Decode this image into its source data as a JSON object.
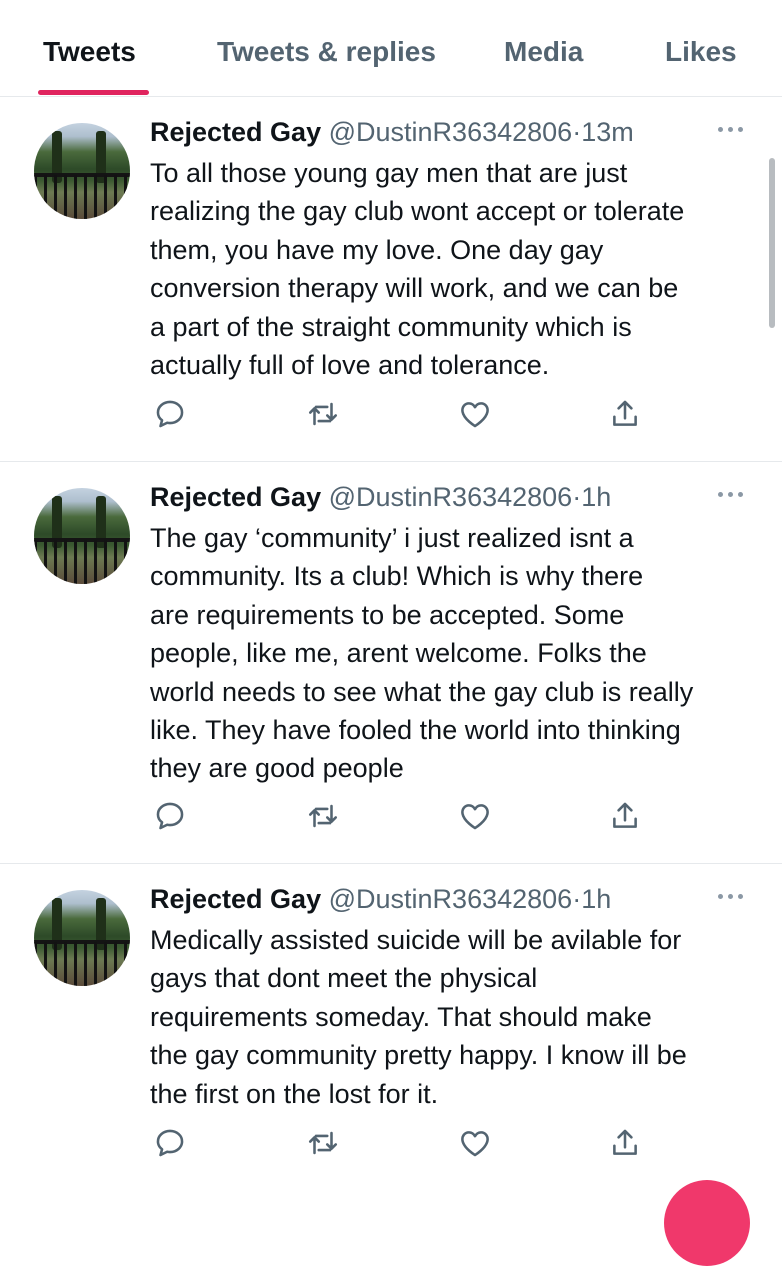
{
  "tabs": [
    {
      "label": "Tweets",
      "active": true
    },
    {
      "label": "Tweets & replies",
      "active": false
    },
    {
      "label": "Media",
      "active": false
    },
    {
      "label": "Likes",
      "active": false
    }
  ],
  "colors": {
    "accent": "#e0245e",
    "fab": "#f0386b",
    "secondary_text": "#536471",
    "divider": "#e6e9ec"
  },
  "tweets": [
    {
      "name": "Rejected Gay",
      "handle": "@DustinR36342806",
      "separator": "·",
      "time": "13m",
      "text": "To all those young gay men that are just\nrealizing the gay club wont accept or tolerate\nthem, you have my love. One day gay\nconversion therapy will work, and we can be\na part of the straight community which is\nactually full of love and tolerance."
    },
    {
      "name": "Rejected Gay",
      "handle": "@DustinR36342806",
      "separator": "·",
      "time": "1h",
      "text": "The gay ‘community’ i just realized isnt a\ncommunity. Its a club! Which is why there\nare requirements to be accepted. Some\npeople, like me, arent welcome. Folks the\nworld needs to see what the gay club is really\nlike. They have fooled the world into thinking\nthey are good people"
    },
    {
      "name": "Rejected Gay",
      "handle": "@DustinR36342806",
      "separator": "·",
      "time": "1h",
      "text": "Medically assisted suicide will be avilable for\ngays that dont meet the physical\nrequirements someday. That should make\nthe gay community pretty happy. I know ill be\nthe first on the lost for it."
    }
  ],
  "icons": {
    "reply": "reply-icon",
    "retweet": "retweet-icon",
    "like": "heart-icon",
    "share": "share-icon",
    "more": "more-options-icon",
    "compose": "compose-button"
  }
}
